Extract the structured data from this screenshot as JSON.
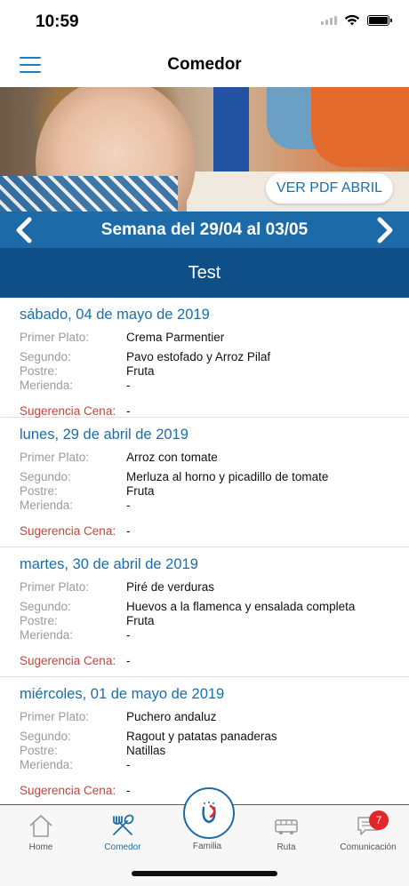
{
  "status_bar": {
    "time": "10:59"
  },
  "nav": {
    "title": "Comedor"
  },
  "hero": {
    "pdf_button": "VER PDF ABRIL"
  },
  "week": {
    "title": "Semana del 29/04 al 03/05"
  },
  "section": {
    "title": "Test"
  },
  "labels": {
    "primer": "Primer Plato:",
    "segundo": "Segundo:",
    "postre": "Postre:",
    "merienda": "Merienda:",
    "sugerencia": "Sugerencia Cena:"
  },
  "days": [
    {
      "date": "sábado, 04 de mayo de 2019",
      "primer": "Crema Parmentier",
      "segundo": "Pavo estofado y Arroz Pilaf",
      "postre": "Fruta",
      "merienda": "-",
      "sugerencia": "-"
    },
    {
      "date": "lunes, 29 de abril de 2019",
      "primer": "Arroz con tomate",
      "segundo": "Merluza al horno y picadillo de tomate",
      "postre": "Fruta",
      "merienda": "-",
      "sugerencia": "-"
    },
    {
      "date": "martes, 30 de abril de 2019",
      "primer": "Piré de verduras",
      "segundo": "Huevos a la flamenca y ensalada completa",
      "postre": "Fruta",
      "merienda": "-",
      "sugerencia": "-"
    },
    {
      "date": "miércoles, 01 de mayo de 2019",
      "primer": "Puchero andaluz",
      "segundo": "Ragout y patatas panaderas",
      "postre": "Natillas",
      "merienda": "-",
      "sugerencia": "-"
    }
  ],
  "tabs": {
    "home": "Home",
    "comedor": "Comedor",
    "familia": "Familia",
    "ruta": "Ruta",
    "comunicacion": "Comunicación",
    "comunicacion_badge": "7"
  },
  "colors": {
    "primary": "#1d6aa8",
    "dark": "#0d4f86",
    "accent_red": "#c0463f",
    "badge": "#e4262a"
  }
}
